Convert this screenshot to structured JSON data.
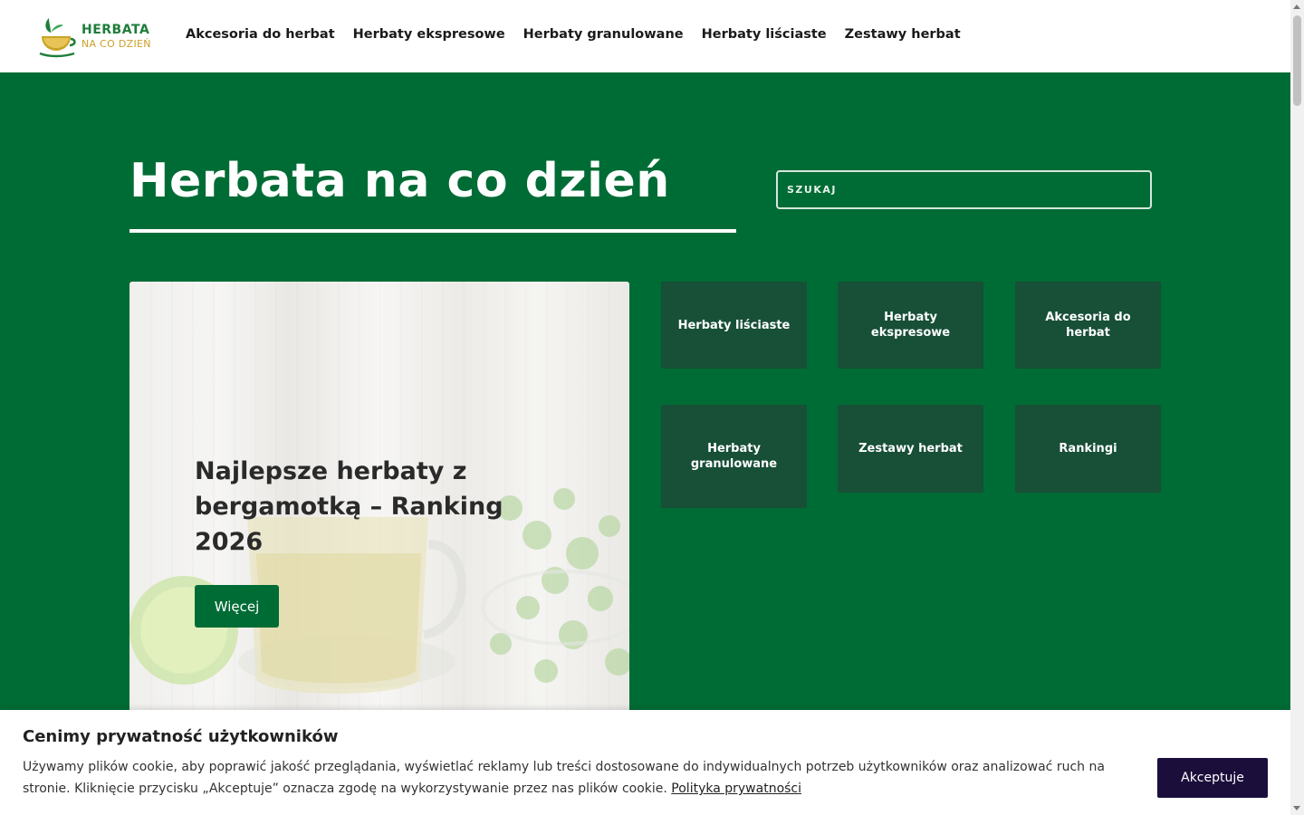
{
  "brand": {
    "line1": "HERBATA",
    "line2": "NA CO DZIEŃ",
    "primary_color": "#006c35",
    "tile_color": "#174f37",
    "accent_gold": "#c9a227"
  },
  "nav": {
    "items": [
      {
        "label": "Akcesoria do herbat"
      },
      {
        "label": "Herbaty ekspresowe"
      },
      {
        "label": "Herbaty granulowane"
      },
      {
        "label": "Herbaty liściaste"
      },
      {
        "label": "Zestawy herbat"
      }
    ]
  },
  "hero": {
    "title": "Herbata na co dzień",
    "search_placeholder": "SZUKAJ"
  },
  "featured": {
    "title": "Najlepsze herbaty z bergamotką – Ranking 2026",
    "button_label": "Więcej"
  },
  "tiles": [
    {
      "label": "Herbaty liściaste"
    },
    {
      "label": "Herbaty ekspresowe"
    },
    {
      "label": "Akcesoria do herbat"
    },
    {
      "label": "Herbaty granulowane"
    },
    {
      "label": "Zestawy herbat"
    },
    {
      "label": "Rankingi"
    }
  ],
  "cookie": {
    "title": "Cenimy prywatność użytkowników",
    "text": "Używamy plików cookie, aby poprawić jakość przeglądania, wyświetlać reklamy lub treści dostosowane do indywidualnych potrzeb użytkowników oraz analizować ruch na stronie. Kliknięcie przycisku „Akceptuje” oznacza zgodę na wykorzystywanie przez nas plików cookie.",
    "link_label": "Polityka prywatności",
    "accept_label": "Akceptuje",
    "accept_color": "#1b0e3b"
  }
}
